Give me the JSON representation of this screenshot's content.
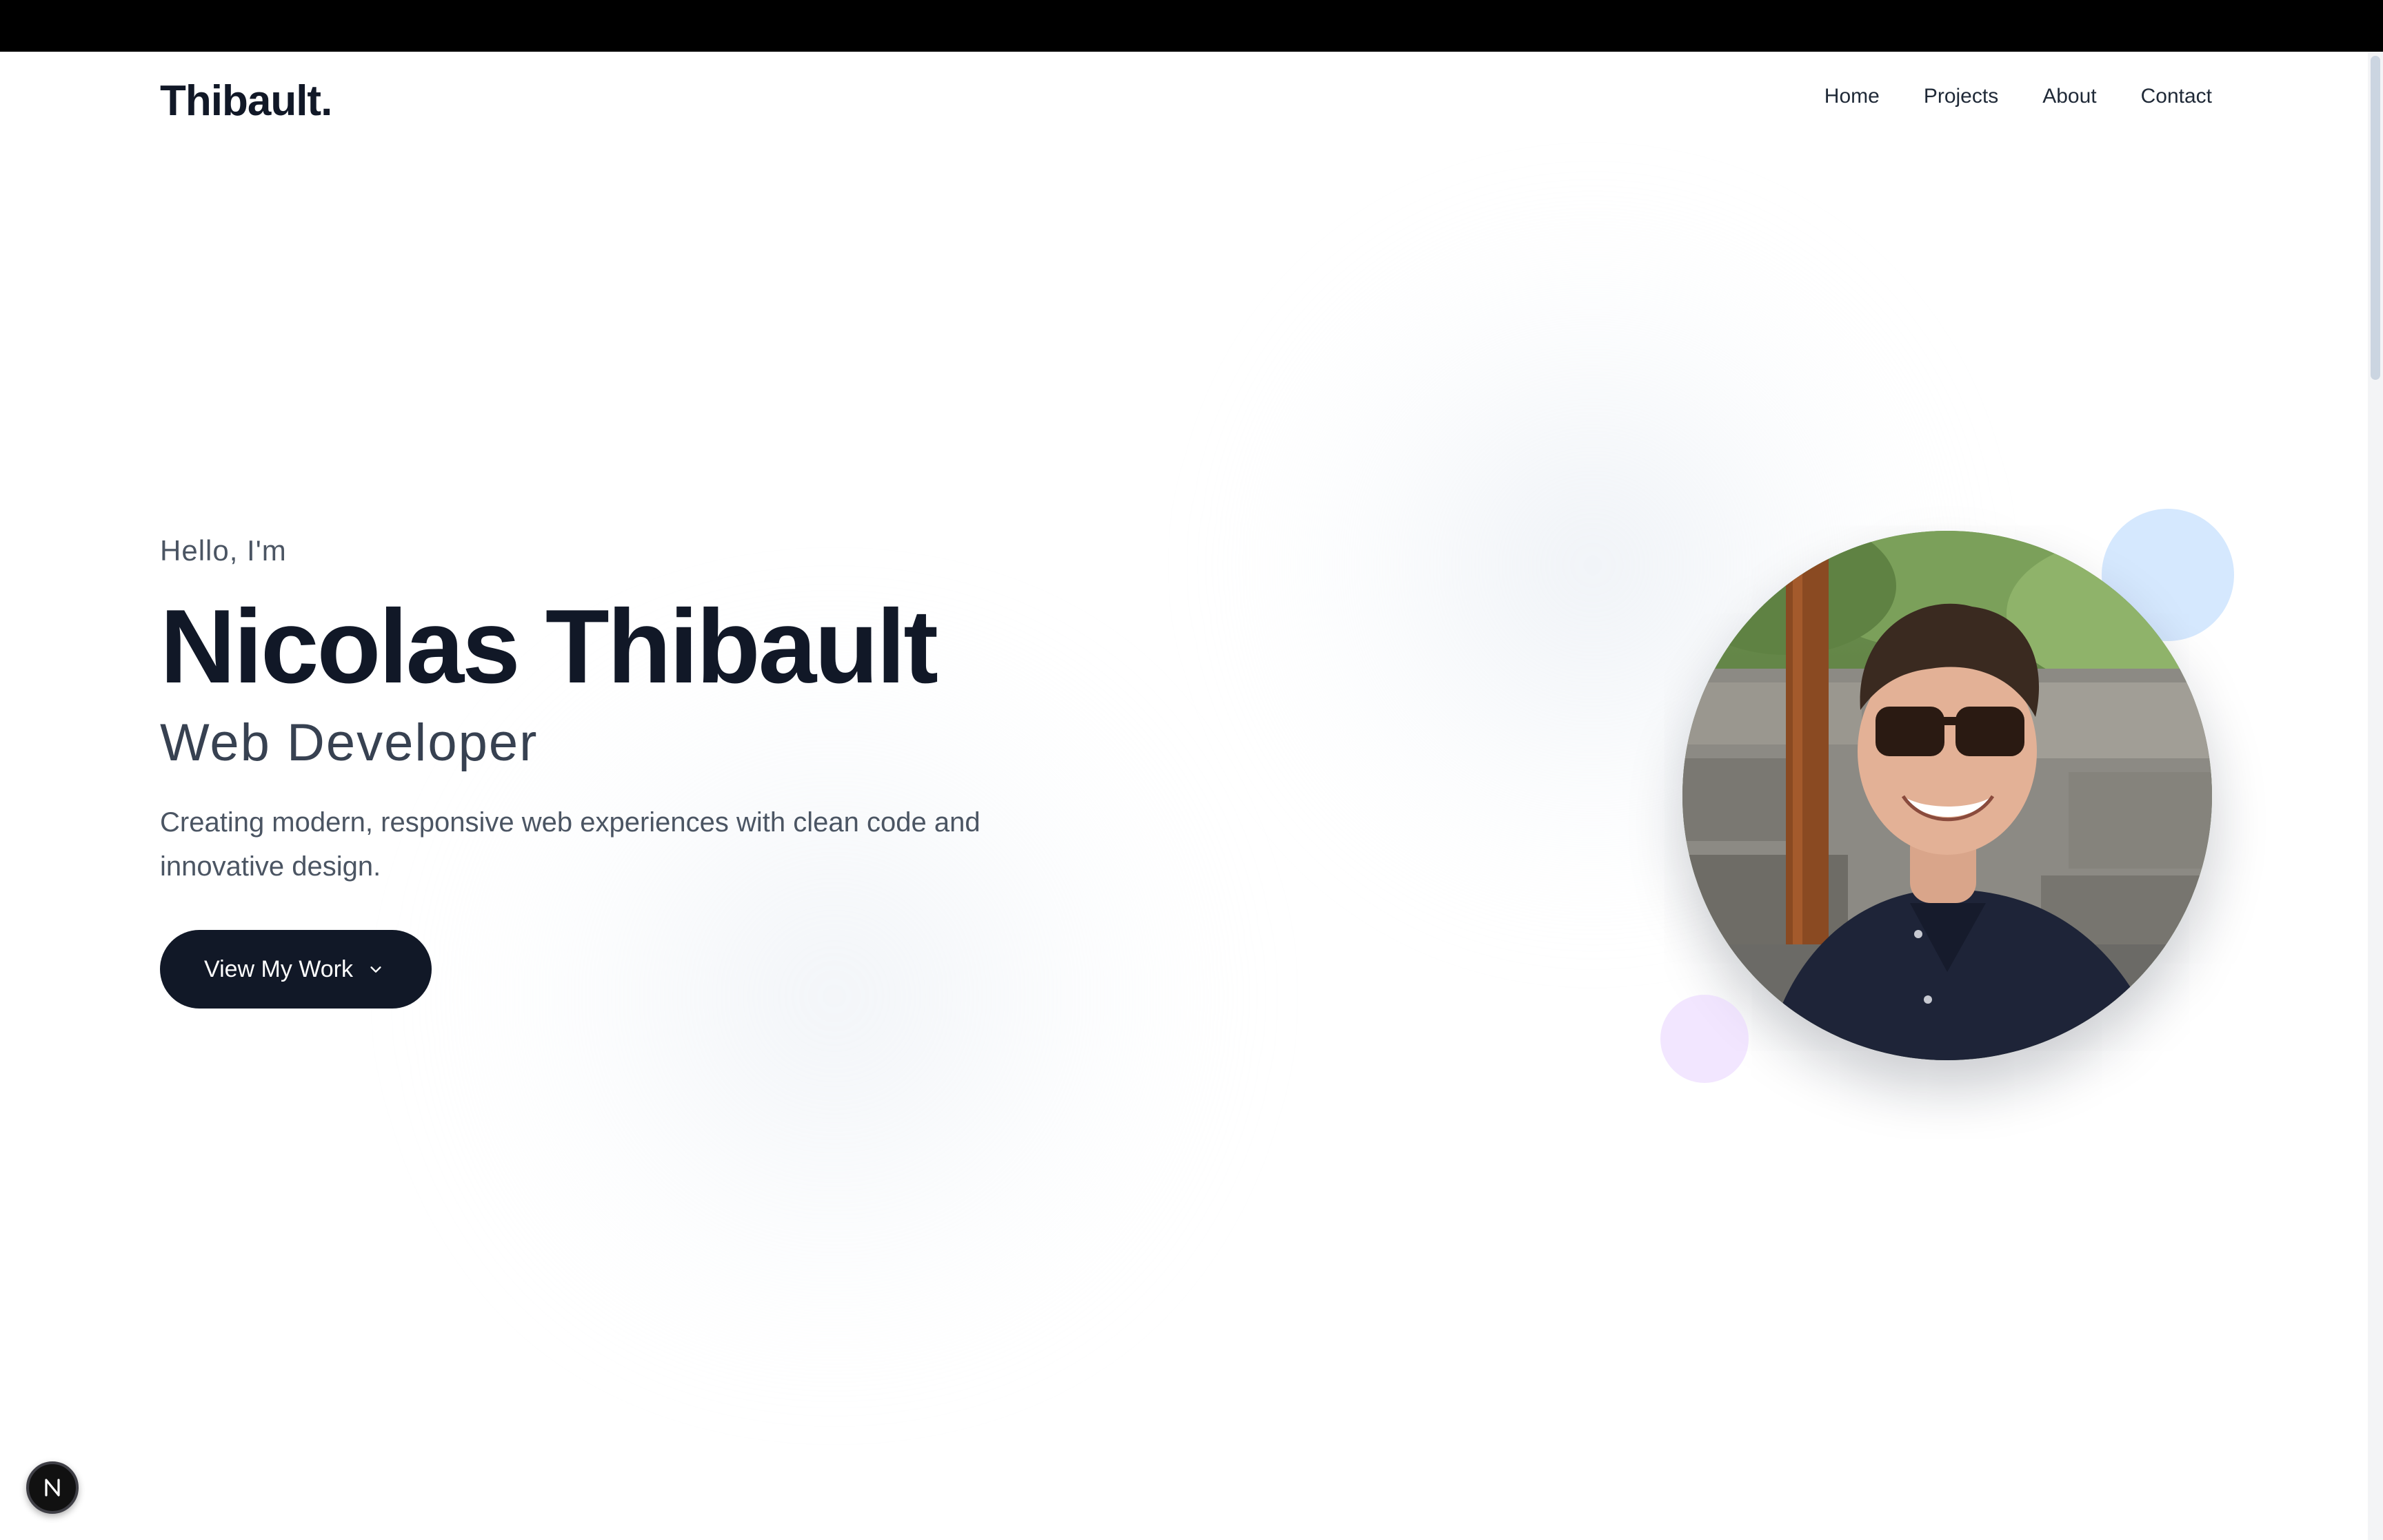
{
  "header": {
    "logo": "Thibault.",
    "nav": [
      "Home",
      "Projects",
      "About",
      "Contact"
    ]
  },
  "hero": {
    "greeting": "Hello, I'm",
    "name": "Nicolas Thibault",
    "role": "Web Developer",
    "tagline_line1": "Creating modern, responsive web experiences with clean code and",
    "tagline_line2": "innovative design.",
    "cta_label": "View My Work",
    "cta_icon": "chevron-down-icon",
    "photo_alt": "Profile photo"
  },
  "dev_badge": {
    "icon": "next-logo-icon",
    "letter": "N"
  },
  "colors": {
    "text_primary": "#111827",
    "button_bg": "#111827",
    "accent_blue": "#bfdbfe",
    "accent_purple": "#e9d5ff",
    "top_bar": "#000000"
  }
}
